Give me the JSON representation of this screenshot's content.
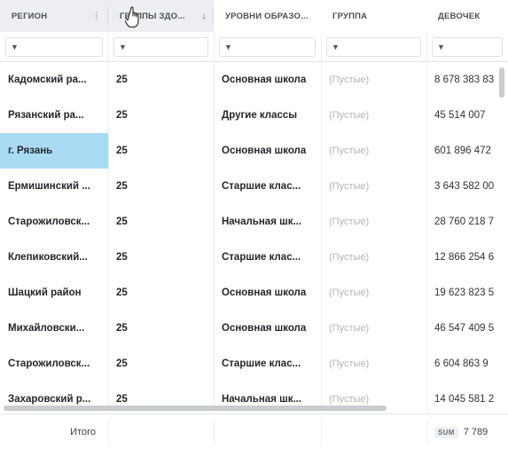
{
  "columns": [
    {
      "label": "РЕГИОН",
      "menu_icon": "column-menu-icon"
    },
    {
      "label": "ГРУППЫ ЗДО...",
      "sort_icon": "sort-down-arrow-icon",
      "sort_glyph": "↓"
    },
    {
      "label": "УРОВНИ ОБРАЗО..."
    },
    {
      "label": "ГРУППА"
    },
    {
      "label": "ДЕВОЧЕК"
    }
  ],
  "filter_icon": "filter-icon",
  "rows": [
    {
      "region": "Кадомский ра...",
      "group_health": "25",
      "level": "Основная школа",
      "group": "(Пустые)",
      "girls": "8 678 383 83"
    },
    {
      "region": "Рязанский ра...",
      "group_health": "25",
      "level": "Другие классы",
      "group": "(Пустые)",
      "girls": "45 514 007"
    },
    {
      "region": "г. Рязань",
      "group_health": "25",
      "level": "Основная школа",
      "group": "(Пустые)",
      "girls": "601 896 472"
    },
    {
      "region": "Ермишинский ...",
      "group_health": "25",
      "level": "Старшие клас...",
      "group": "(Пустые)",
      "girls": "3 643 582 00"
    },
    {
      "region": "Старожиловск...",
      "group_health": "25",
      "level": "Начальная шк...",
      "group": "(Пустые)",
      "girls": "28 760 218 7"
    },
    {
      "region": "Клепиковский...",
      "group_health": "25",
      "level": "Старшие клас...",
      "group": "(Пустые)",
      "girls": "12 866 254 6"
    },
    {
      "region": "Шацкий район",
      "group_health": "25",
      "level": "Основная школа",
      "group": "(Пустые)",
      "girls": "19 623 823 5"
    },
    {
      "region": "Михайловски...",
      "group_health": "25",
      "level": "Основная школа",
      "group": "(Пустые)",
      "girls": "46 547 409 5"
    },
    {
      "region": "Старожиловск...",
      "group_health": "25",
      "level": "Старшие клас...",
      "group": "(Пустые)",
      "girls": "6 604 863 9"
    },
    {
      "region": "Захаровский р...",
      "group_health": "25",
      "level": "Начальная шк...",
      "group": "(Пустые)",
      "girls": "14 045 581 2"
    }
  ],
  "selected_row_index": 2,
  "footer": {
    "total_label": "Итого",
    "sum_badge": "SUM",
    "sum_value": "7 789"
  },
  "colors": {
    "selected_cell": "#a9dbf5",
    "header_active": "#eceef1",
    "empty_text": "#b0b4b9"
  }
}
